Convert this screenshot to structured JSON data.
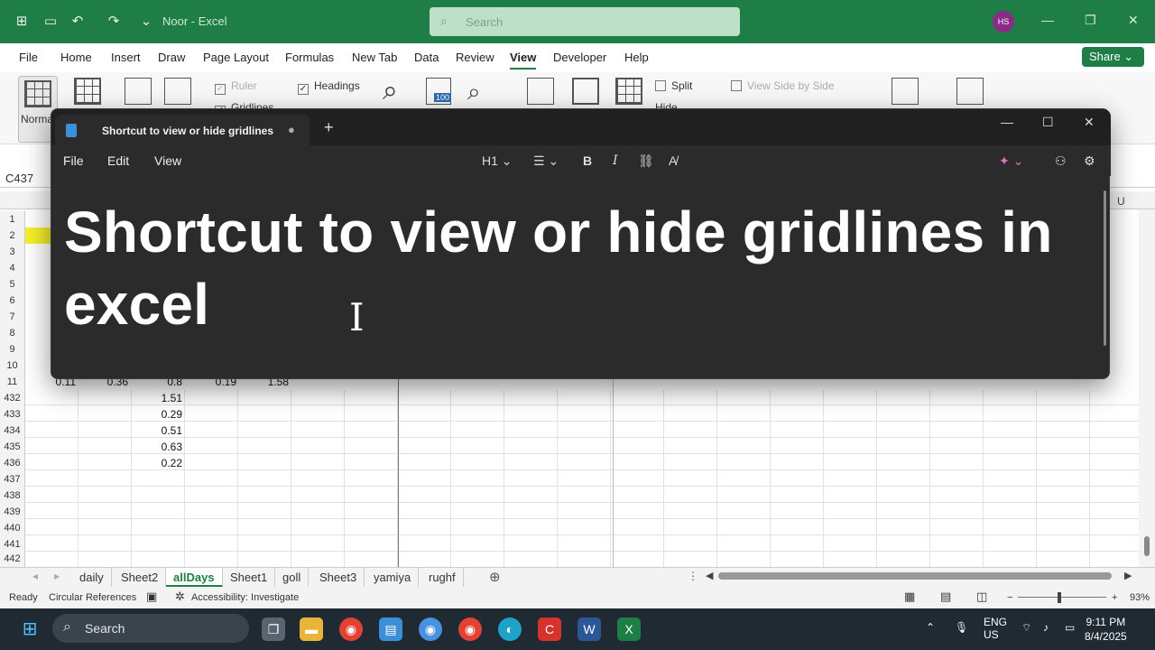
{
  "excel": {
    "doc_title": "Noor  -  Excel",
    "search_placeholder": "Search",
    "avatar_initials": "HS",
    "menu": [
      "File",
      "Home",
      "Insert",
      "Draw",
      "Page Layout",
      "Formulas",
      "New Tab",
      "Data",
      "Review",
      "View",
      "Developer",
      "Help"
    ],
    "active_menu": "View",
    "share_label": "Share ⌄",
    "ribbon": {
      "normal_label": "Normal",
      "ruler_label": "Ruler",
      "gridlines_label": "Gridlines",
      "headings_label": "Headings",
      "split_label": "Split",
      "hide_label": "Hide",
      "view_side_label": "View Side by Side",
      "zoom_value": "100"
    },
    "namebox": "C437",
    "col_u": "U",
    "rows_top": [
      "1",
      "2",
      "3",
      "4",
      "5",
      "6",
      "7",
      "8",
      "9",
      "10",
      "11"
    ],
    "row11_values": [
      "0.11",
      "0.36",
      "0.8",
      "0.19",
      "1.58"
    ],
    "rows_bottom": [
      "432",
      "433",
      "434",
      "435",
      "436",
      "437",
      "438",
      "439",
      "440",
      "441",
      "442"
    ],
    "col_c_values": [
      "1.51",
      "0.29",
      "0.51",
      "0.63",
      "0.22"
    ],
    "sheet_tabs": [
      "daily",
      "Sheet2",
      "allDays",
      "Sheet1",
      "goll",
      "Sheet3",
      "yamiya",
      "rughf"
    ],
    "active_tab": "allDays",
    "status": {
      "ready": "Ready",
      "circular": "Circular References",
      "accessibility": "Accessibility: Investigate",
      "zoom": "93%"
    }
  },
  "notepad": {
    "tab_title": "Shortcut to view or hide gridlines",
    "menu": [
      "File",
      "Edit",
      "View"
    ],
    "heading_dropdown": "H1",
    "body_text": "Shortcut to view or hide gridlines in excel"
  },
  "taskbar": {
    "search_label": "Search",
    "lang_line1": "ENG",
    "lang_line2": "US",
    "time": "9:11 PM",
    "date": "8/4/2025"
  },
  "colors": {
    "excel_green": "#1e7e45",
    "notepad_bg": "#2b2b2b",
    "highlight": "#f5ef2a"
  }
}
